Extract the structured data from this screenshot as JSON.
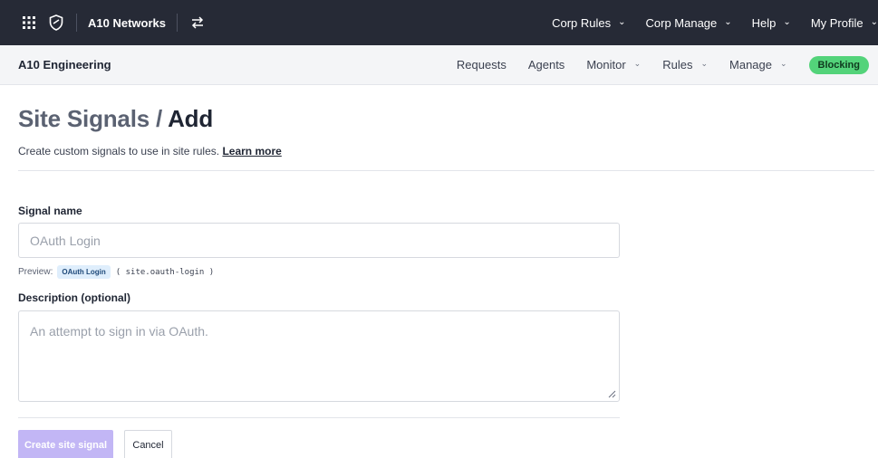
{
  "topbar": {
    "corp_name": "A10 Networks",
    "nav": [
      {
        "label": "Corp Rules"
      },
      {
        "label": "Corp Manage"
      },
      {
        "label": "Help"
      },
      {
        "label": "My Profile"
      }
    ]
  },
  "subbar": {
    "site_name": "A10 Engineering",
    "nav": [
      {
        "label": "Requests"
      },
      {
        "label": "Agents"
      },
      {
        "label": "Monitor"
      },
      {
        "label": "Rules"
      },
      {
        "label": "Manage"
      }
    ],
    "status_badge": "Blocking"
  },
  "page": {
    "title_crumb": "Site Signals",
    "title_sep": "/",
    "title_current": "Add",
    "subtitle": "Create custom signals to use in site rules.",
    "learn_more": "Learn more"
  },
  "form": {
    "signal_name_label": "Signal name",
    "signal_name_placeholder": "OAuth Login",
    "preview_label": "Preview:",
    "preview_chip": "OAuth Login",
    "preview_code": "( site.oauth-login )",
    "description_label": "Description (optional)",
    "description_placeholder": "An attempt to sign in via OAuth.",
    "submit_label": "Create site signal",
    "cancel_label": "Cancel"
  },
  "colors": {
    "topbar_bg": "#262a36",
    "subbar_bg": "#f4f5f7",
    "badge_bg": "#53d37a",
    "primary_button_disabled": "#c2b6f5"
  }
}
